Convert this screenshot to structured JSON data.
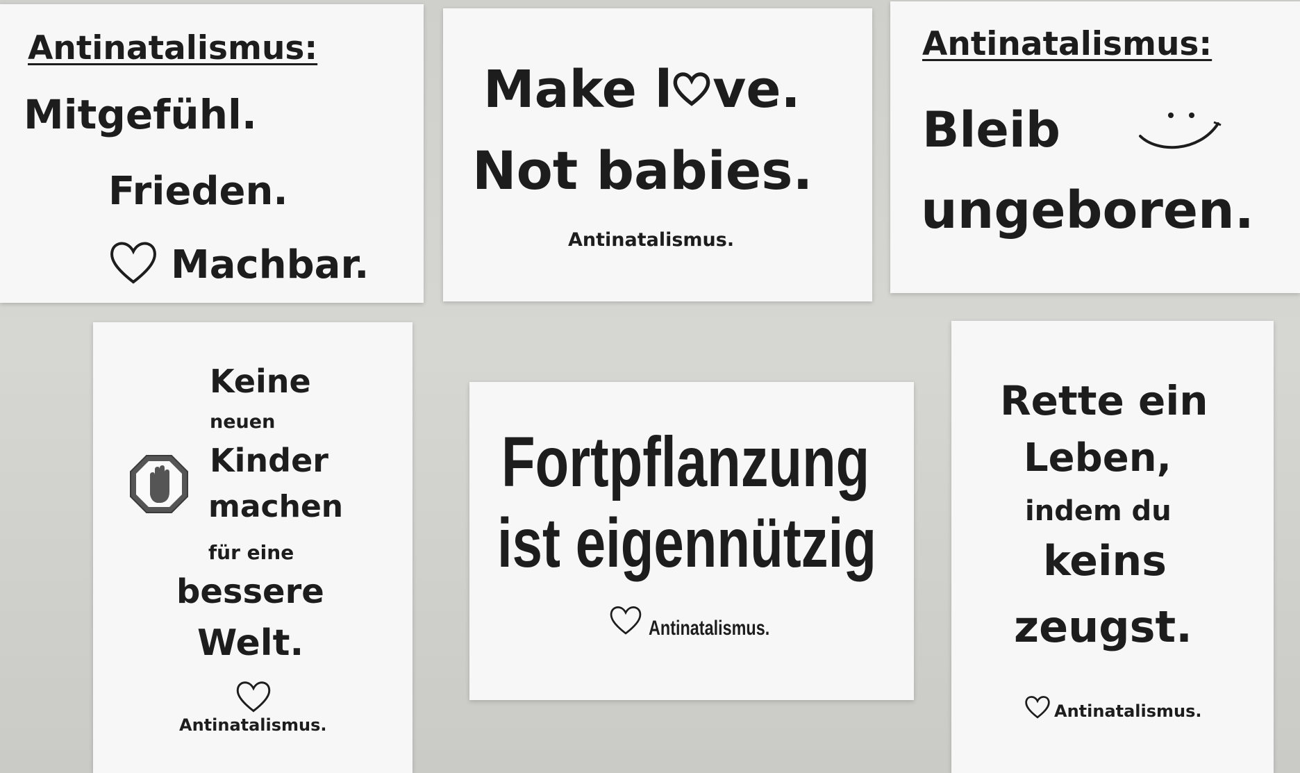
{
  "posters": {
    "p1": {
      "heading": "Antinatalismus:",
      "line1": "Mitgefühl.",
      "line2": "Frieden.",
      "line3": "Machbar."
    },
    "p2": {
      "line1_a": "Make l",
      "line1_b": "ve.",
      "line2": "Not babies.",
      "footer": "Antinatalismus."
    },
    "p3": {
      "heading": "Antinatalismus:",
      "line1": "Bleib",
      "line2": "ungeboren."
    },
    "p4": {
      "line1": "Keine",
      "line2": "neuen",
      "line3": "Kinder",
      "line4": "machen",
      "line5": "für eine",
      "line6": "bessere",
      "line7": "Welt.",
      "footer": "Antinatalismus."
    },
    "p5": {
      "line1": "Fortpflanzung",
      "line2": "ist eigennützig",
      "footer": "Antinatalismus."
    },
    "p6": {
      "line1": "Rette ein",
      "line2": "Leben,",
      "line3": "indem du",
      "line4": "keins",
      "line5": "zeugst.",
      "footer": "Antinatalismus."
    }
  },
  "icons": [
    "heart-icon",
    "smiley-icon",
    "stop-hand-icon"
  ]
}
